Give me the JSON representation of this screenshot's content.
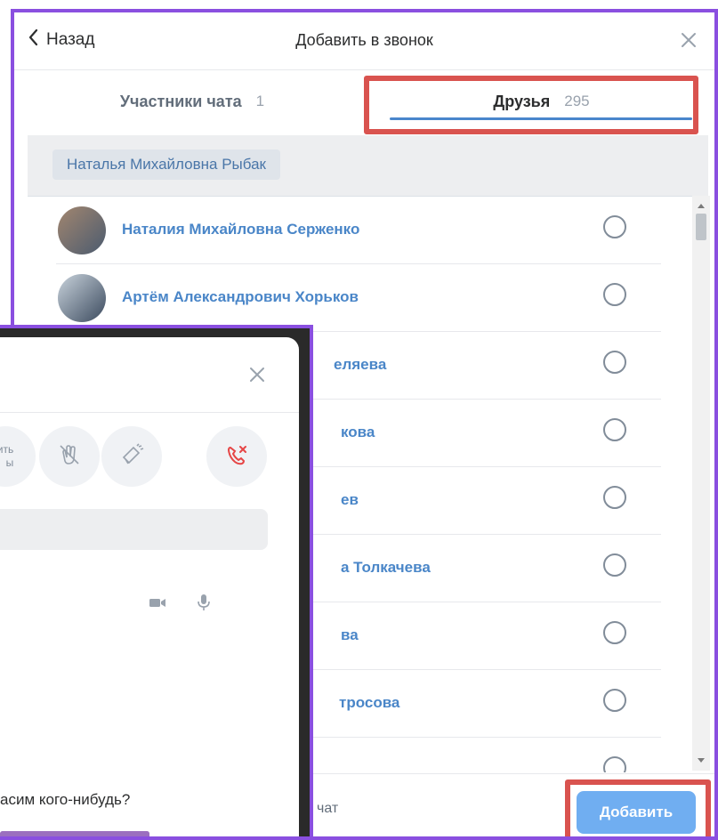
{
  "header": {
    "back_label": "Назад",
    "title": "Добавить в звонок"
  },
  "tabs": [
    {
      "label": "Участники чата",
      "count": "1"
    },
    {
      "label": "Друзья",
      "count": "295"
    }
  ],
  "selected": {
    "chip": "Наталья Михайловна Рыбак"
  },
  "friends": [
    {
      "name": "Наталия Михайловна Серженко"
    },
    {
      "name": "Артём Александрович Хорьков"
    },
    {
      "name": "еляева"
    },
    {
      "name": "кова"
    },
    {
      "name": "ев"
    },
    {
      "name": "а Толкачева"
    },
    {
      "name": "ва"
    },
    {
      "name": "тросова"
    }
  ],
  "footer": {
    "add_label": "Добавить",
    "chat_label": "чат"
  },
  "overlay": {
    "btn_text": "ить\nы",
    "question": "асим кого-нибудь?"
  },
  "colors": {
    "accent": "#4986cc",
    "highlight": "#d9534f",
    "frame": "#8a4fe0",
    "button": "#70aef1",
    "name": "#4a86c8"
  }
}
